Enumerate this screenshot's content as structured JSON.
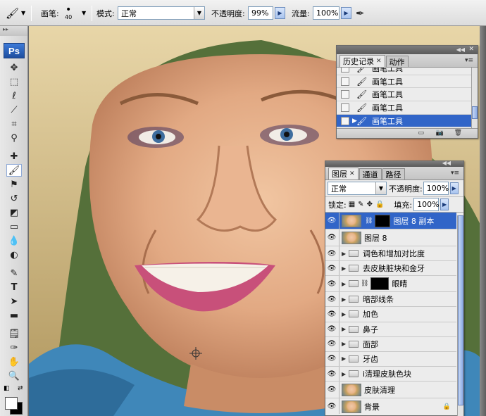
{
  "optbar": {
    "brush_label": "画笔:",
    "brush_size": "40",
    "mode_label": "模式:",
    "mode_value": "正常",
    "opacity_label": "不透明度:",
    "opacity_value": "99%",
    "flow_label": "流量:",
    "flow_value": "100%"
  },
  "toolbox": {
    "logo": "Ps",
    "tools": [
      "move-tool",
      "marquee-tool",
      "lasso-tool",
      "quick-select-tool",
      "crop-tool",
      "eyedropper-tool",
      "healing-brush-tool",
      "brush-tool",
      "clone-stamp-tool",
      "history-brush-tool",
      "eraser-tool",
      "gradient-tool",
      "blur-tool",
      "dodge-tool",
      "pen-tool",
      "type-tool",
      "path-select-tool",
      "shape-tool",
      "notes-tool",
      "eyedropper-2-tool",
      "hand-tool",
      "zoom-tool"
    ]
  },
  "history_panel": {
    "tabs": [
      "历史记录",
      "动作"
    ],
    "items": [
      "画笔工具",
      "画笔工具",
      "画笔工具",
      "画笔工具",
      "画笔工具"
    ],
    "selected_index": 4
  },
  "layers_panel": {
    "tabs": [
      "图层",
      "通道",
      "路径"
    ],
    "blend_mode": "正常",
    "opacity_label": "不透明度:",
    "opacity_value": "100%",
    "lock_label": "锁定:",
    "fill_label": "填充:",
    "fill_value": "100%",
    "layers": [
      {
        "name": "图层 8 副本",
        "kind": "image-mask",
        "selected": true
      },
      {
        "name": "图层 8",
        "kind": "image",
        "selected": false
      },
      {
        "name": "调色和增加对比度",
        "kind": "group",
        "selected": false
      },
      {
        "name": "去皮肤脏块和金牙",
        "kind": "group",
        "selected": false
      },
      {
        "name": "眼睛",
        "kind": "group-mask",
        "selected": false
      },
      {
        "name": "暗部线条",
        "kind": "group",
        "selected": false
      },
      {
        "name": "加色",
        "kind": "group",
        "selected": false
      },
      {
        "name": "鼻子",
        "kind": "group",
        "selected": false
      },
      {
        "name": "面部",
        "kind": "group",
        "selected": false
      },
      {
        "name": "牙齿",
        "kind": "group",
        "selected": false
      },
      {
        "name": "i清理皮肤色块",
        "kind": "group",
        "selected": false
      },
      {
        "name": "皮肤清理",
        "kind": "image",
        "selected": false
      },
      {
        "name": "背景",
        "kind": "image",
        "selected": false
      }
    ]
  },
  "colors": {
    "selection": "#3165c8",
    "foreground": "#ffffff",
    "background": "#000000"
  }
}
